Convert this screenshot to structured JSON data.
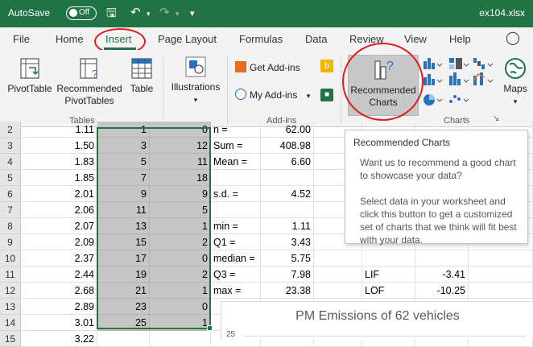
{
  "titlebar": {
    "autosave": "AutoSave",
    "toggle": "Off",
    "filename": "ex104.xlsx"
  },
  "tabs": [
    "File",
    "Home",
    "Insert",
    "Page Layout",
    "Formulas",
    "Data",
    "Review",
    "View",
    "Help"
  ],
  "ribbon": {
    "pivottable": "PivotTable",
    "rec_pivot_1": "Recommended",
    "rec_pivot_2": "PivotTables",
    "table": "Table",
    "tables_group": "Tables",
    "illustrations": "Illustrations",
    "get_addins": "Get Add-ins",
    "my_addins": "My Add-ins",
    "addins_group": "Add-ins",
    "rec_charts_1": "Recommended",
    "rec_charts_2": "Charts",
    "maps": "Maps",
    "charts_group": "Charts"
  },
  "tooltip": {
    "title": "Recommended Charts",
    "p1": "Want us to recommend a good chart to showcase your data?",
    "p2": "Select data in your worksheet and click this button to get a customized set of charts that we think will fit best with your data."
  },
  "rows": [
    {
      "n": "2",
      "b": "1.11",
      "c": "1",
      "d": "0",
      "e": "n =",
      "f": "62.00",
      "h": "",
      "i": ""
    },
    {
      "n": "3",
      "b": "1.50",
      "c": "3",
      "d": "12",
      "e": "Sum =",
      "f": "408.98",
      "h": "",
      "i": ""
    },
    {
      "n": "4",
      "b": "1.83",
      "c": "5",
      "d": "11",
      "e": "Mean =",
      "f": "6.60",
      "h": "",
      "i": ""
    },
    {
      "n": "5",
      "b": "1.85",
      "c": "7",
      "d": "18",
      "e": "",
      "f": "",
      "h": "",
      "i": ""
    },
    {
      "n": "6",
      "b": "2.01",
      "c": "9",
      "d": "9",
      "e": "s.d. =",
      "f": "4.52",
      "h": "",
      "i": ""
    },
    {
      "n": "7",
      "b": "2.06",
      "c": "11",
      "d": "5",
      "e": "",
      "f": "",
      "h": "",
      "i": ""
    },
    {
      "n": "8",
      "b": "2.07",
      "c": "13",
      "d": "1",
      "e": "min =",
      "f": "1.11",
      "h": "",
      "i": ""
    },
    {
      "n": "9",
      "b": "2.09",
      "c": "15",
      "d": "2",
      "e": "Q1 =",
      "f": "3.43",
      "h": "",
      "i": ""
    },
    {
      "n": "10",
      "b": "2.37",
      "c": "17",
      "d": "0",
      "e": "median =",
      "f": "5.75",
      "h": "",
      "i": ""
    },
    {
      "n": "11",
      "b": "2.44",
      "c": "19",
      "d": "2",
      "e": "Q3 =",
      "f": "7.98",
      "h": "LIF",
      "i": "-3.41"
    },
    {
      "n": "12",
      "b": "2.68",
      "c": "21",
      "d": "1",
      "e": "max =",
      "f": "23.38",
      "h": "LOF",
      "i": "-10.25"
    },
    {
      "n": "13",
      "b": "2.89",
      "c": "23",
      "d": "0",
      "e": "",
      "f": "",
      "h": "",
      "i": ""
    },
    {
      "n": "14",
      "b": "3.01",
      "c": "25",
      "d": "1",
      "e": "",
      "f": "",
      "h": "",
      "i": ""
    },
    {
      "n": "15",
      "b": "3.22",
      "c": "",
      "d": "",
      "e": "",
      "f": "",
      "h": "",
      "i": ""
    }
  ],
  "chart": {
    "title": "PM Emissions of 62 vehicles",
    "ytick": "25"
  },
  "colors": {
    "excel_green": "#217346",
    "annotation_red": "#e01b1b"
  }
}
